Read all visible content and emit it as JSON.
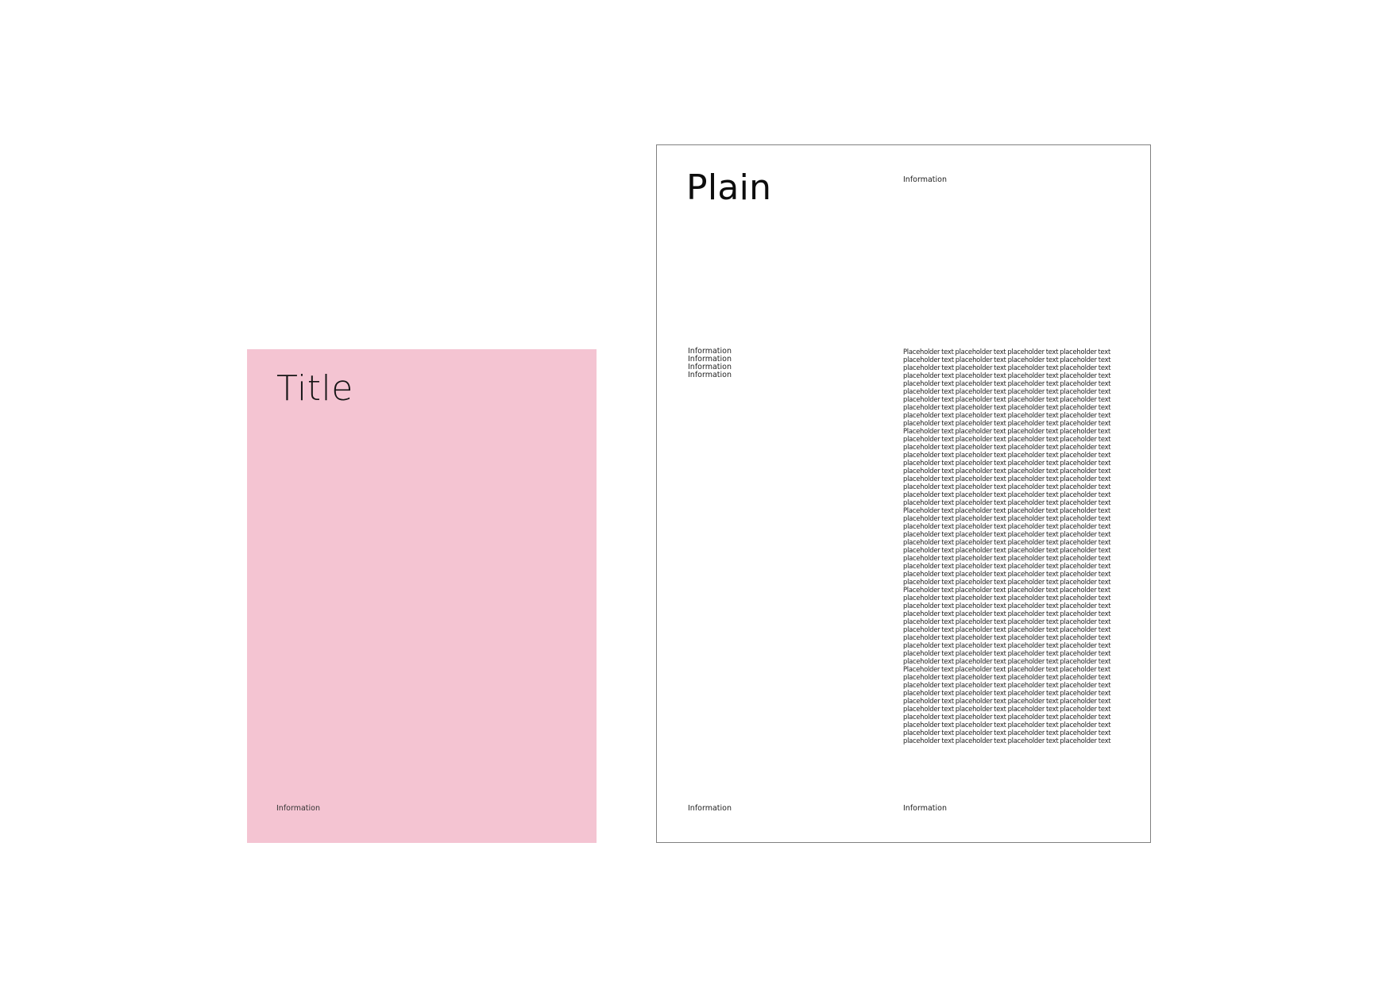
{
  "cover": {
    "title": "Title",
    "info": "Information",
    "background_color": "#f4c4d2"
  },
  "page": {
    "title": "Plain",
    "header_info": "Information",
    "side_info": [
      "Information",
      "Information",
      "Information",
      "Information"
    ],
    "body_lines": [
      "Placeholder text placeholder text placeholder text placeholder text",
      "placeholder text placeholder text placeholder text placeholder text",
      "placeholder text placeholder text placeholder text placeholder text",
      "placeholder text placeholder text placeholder text placeholder text",
      "placeholder text placeholder text placeholder text placeholder text",
      "placeholder text placeholder text placeholder text placeholder text",
      "placeholder text placeholder text placeholder text placeholder text",
      "placeholder text placeholder text placeholder text placeholder text",
      "placeholder text placeholder text placeholder text placeholder text",
      "placeholder text placeholder text placeholder text placeholder text",
      "Placeholder text placeholder text placeholder text placeholder text",
      "placeholder text placeholder text placeholder text placeholder text",
      "placeholder text placeholder text placeholder text placeholder text",
      "placeholder text placeholder text placeholder text placeholder text",
      "placeholder text placeholder text placeholder text placeholder text",
      "placeholder text placeholder text placeholder text placeholder text",
      "placeholder text placeholder text placeholder text placeholder text",
      "placeholder text placeholder text placeholder text placeholder text",
      "placeholder text placeholder text placeholder text placeholder text",
      "placeholder text placeholder text placeholder text placeholder text",
      "Placeholder text placeholder text placeholder text placeholder text",
      "placeholder text placeholder text placeholder text placeholder text",
      "placeholder text placeholder text placeholder text placeholder text",
      "placeholder text placeholder text placeholder text placeholder text",
      "placeholder text placeholder text placeholder text placeholder text",
      "placeholder text placeholder text placeholder text placeholder text",
      "placeholder text placeholder text placeholder text placeholder text",
      "placeholder text placeholder text placeholder text placeholder text",
      "placeholder text placeholder text placeholder text placeholder text",
      "placeholder text placeholder text placeholder text placeholder text",
      "Placeholder text placeholder text placeholder text placeholder text",
      "placeholder text placeholder text placeholder text placeholder text",
      "placeholder text placeholder text placeholder text placeholder text",
      "placeholder text placeholder text placeholder text placeholder text",
      "placeholder text placeholder text placeholder text placeholder text",
      "placeholder text placeholder text placeholder text placeholder text",
      "placeholder text placeholder text placeholder text placeholder text",
      "placeholder text placeholder text placeholder text placeholder text",
      "placeholder text placeholder text placeholder text placeholder text",
      "placeholder text placeholder text placeholder text placeholder text",
      "Placeholder text placeholder text placeholder text placeholder text",
      "placeholder text placeholder text placeholder text placeholder text",
      "placeholder text placeholder text placeholder text placeholder text",
      "placeholder text placeholder text placeholder text placeholder text",
      "placeholder text placeholder text placeholder text placeholder text",
      "placeholder text placeholder text placeholder text placeholder text",
      "placeholder text placeholder text placeholder text placeholder text",
      "placeholder text placeholder text placeholder text placeholder text",
      "placeholder text placeholder text placeholder text placeholder text",
      "placeholder text placeholder text placeholder text placeholder text"
    ],
    "footer_left": "Information",
    "footer_right": "Information",
    "border_color": "#808080"
  }
}
